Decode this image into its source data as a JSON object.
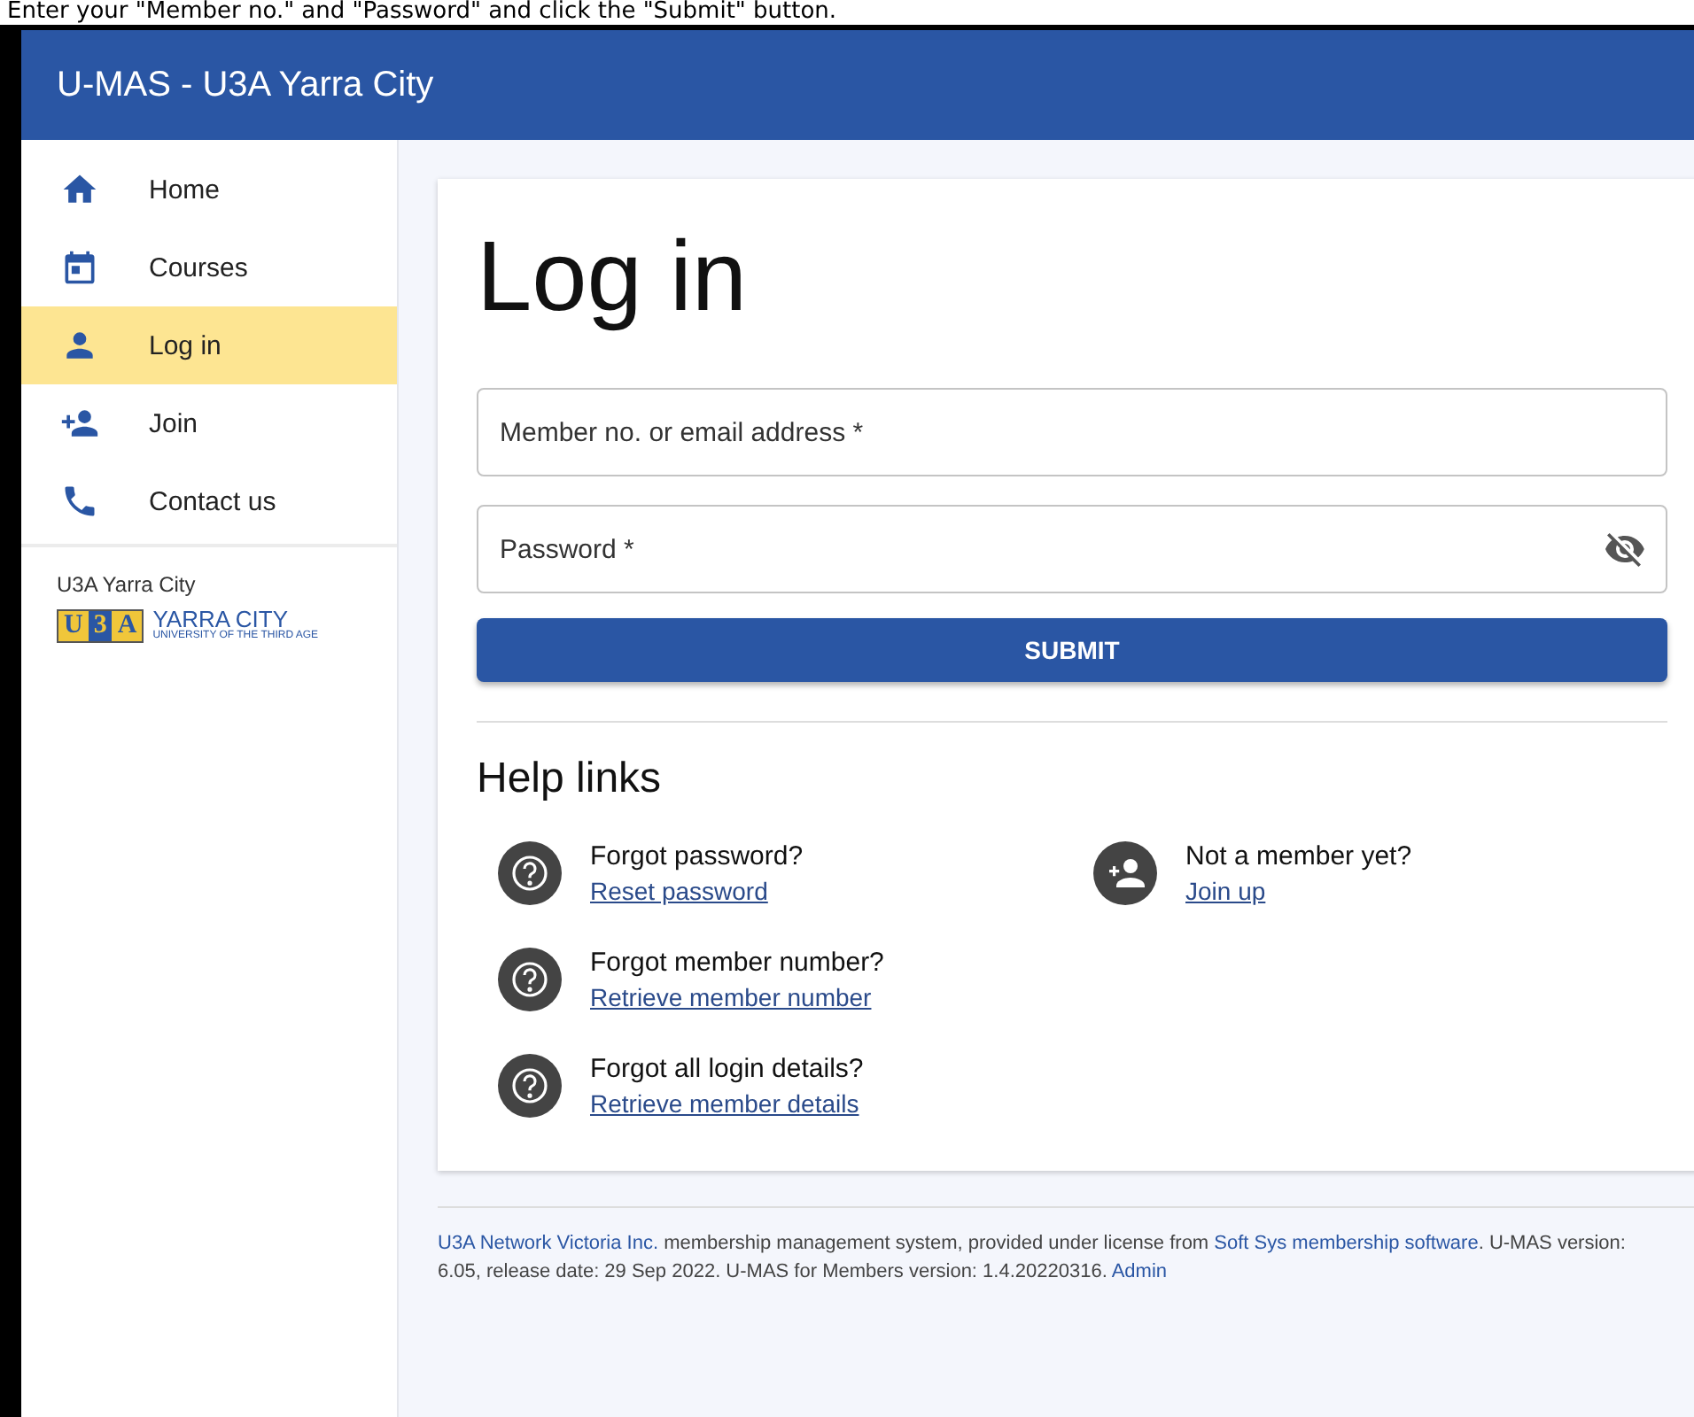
{
  "caption": "Enter your \"Member no.\" and \"Password\" and click the \"Submit\" button.",
  "app_bar": {
    "title": "U-MAS - U3A Yarra City"
  },
  "sidebar": {
    "items": [
      {
        "label": "Home",
        "selected": false
      },
      {
        "label": "Courses",
        "selected": false
      },
      {
        "label": "Log in",
        "selected": true
      },
      {
        "label": "Join",
        "selected": false
      },
      {
        "label": "Contact us",
        "selected": false
      }
    ],
    "org_name": "U3A Yarra City",
    "logo": {
      "letters": [
        "U",
        "3",
        "A"
      ],
      "name": "YARRA CITY",
      "tagline": "UNIVERSITY OF THE THIRD AGE"
    }
  },
  "login": {
    "heading": "Log in",
    "fields": [
      {
        "placeholder": "Member no. or email address *",
        "kind": "text"
      },
      {
        "placeholder": "Password *",
        "kind": "password"
      }
    ],
    "submit": "SUBMIT",
    "help_heading": "Help links",
    "help_links": [
      {
        "question": "Forgot password?",
        "link": "Reset password"
      },
      {
        "question": "Not a member yet?",
        "link": "Join up"
      },
      {
        "question": "Forgot member number?",
        "link": "Retrieve member number"
      },
      {
        "question": "Forgot all login details?",
        "link": "Retrieve member details"
      }
    ]
  },
  "footer": [
    {
      "text": "U3A Network Victoria Inc.",
      "kind": "link"
    },
    {
      "text": " membership management system, provided under license from ",
      "kind": "text"
    },
    {
      "text": "Soft Sys membership software",
      "kind": "link"
    },
    {
      "text": ". U-MAS version: 6.05, release date: 29 Sep 2022. U-MAS for Members version: 1.4.20220316. ",
      "kind": "text"
    },
    {
      "text": "Admin",
      "kind": "link"
    }
  ]
}
